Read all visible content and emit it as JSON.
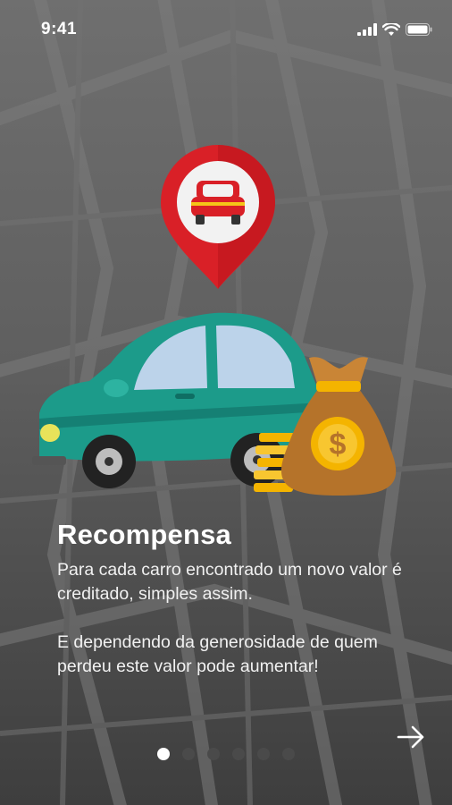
{
  "status_bar": {
    "time": "9:41",
    "icons": [
      "signal-icon",
      "wifi-icon",
      "battery-icon"
    ]
  },
  "illustration": {
    "pin_icon": "car-location-pin-icon",
    "car": "car-illustration",
    "money": "money-bag-icon"
  },
  "onboarding": {
    "title": "Recompensa",
    "paragraph1": "Para cada carro encontrado um novo valor é creditado, simples assim.",
    "paragraph2": "E dependendo da generosidade de quem perdeu este valor pode aumentar!",
    "next_icon": "arrow-right-icon"
  },
  "pagination": {
    "total": 6,
    "current": 1
  },
  "colors": {
    "pin_red": "#d92027",
    "car_teal": "#1c9b8a",
    "money_gold": "#f4b400",
    "bag_brown": "#b5732a"
  }
}
